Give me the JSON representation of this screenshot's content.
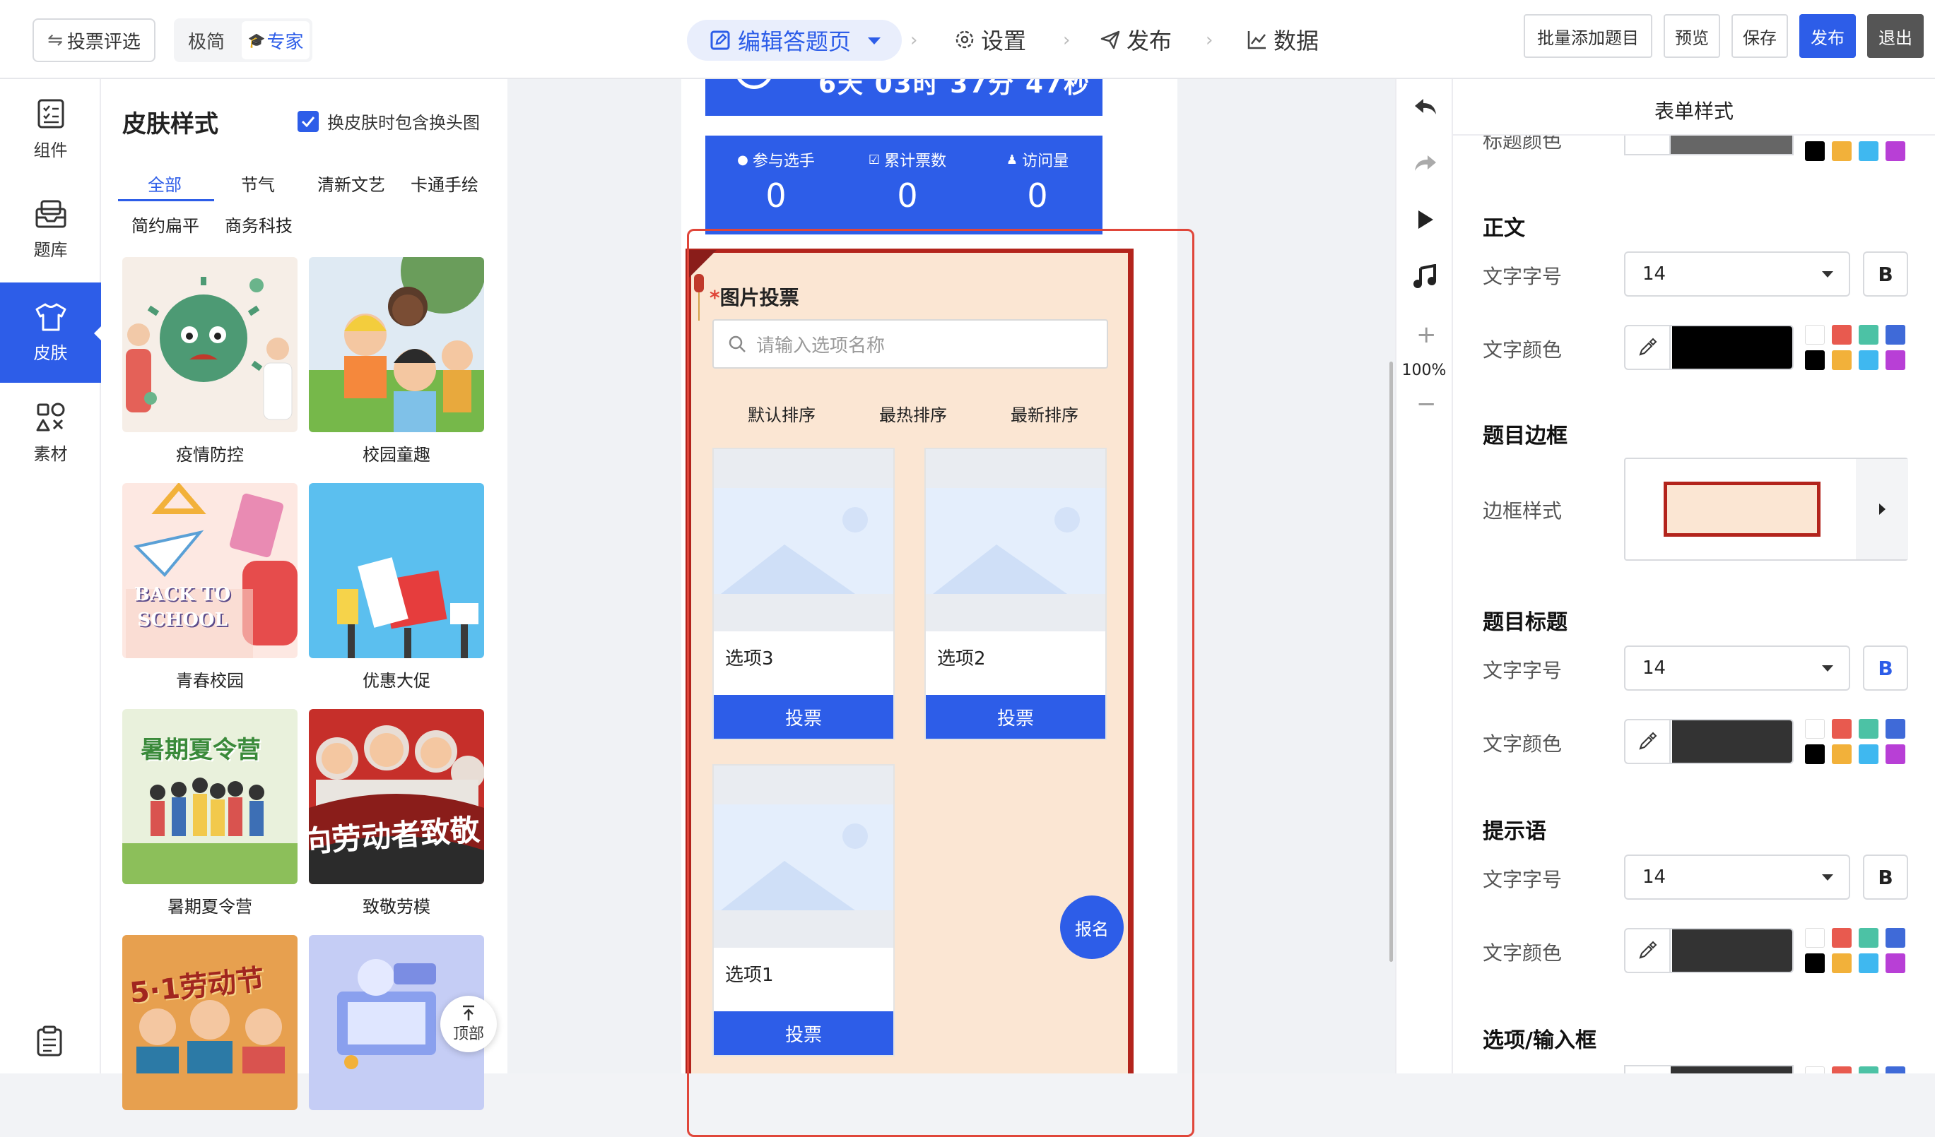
{
  "topbar": {
    "back_label": "投票评选",
    "mode_simple": "极简",
    "mode_expert": "专家",
    "nav_edit": "编辑答题页",
    "nav_settings": "设置",
    "nav_publish": "发布",
    "nav_data": "数据",
    "btn_batch_add": "批量添加题目",
    "btn_preview": "预览",
    "btn_save": "保存",
    "btn_publish": "发布",
    "btn_exit": "退出"
  },
  "rail": {
    "items": [
      {
        "label": "组件",
        "icon": "checklist-icon"
      },
      {
        "label": "题库",
        "icon": "inbox-icon"
      },
      {
        "label": "皮肤",
        "icon": "shirt-icon"
      },
      {
        "label": "素材",
        "icon": "shapes-icon"
      }
    ]
  },
  "skin_panel": {
    "title": "皮肤样式",
    "checkbox_label": "换皮肤时包含换头图",
    "checkbox_checked": true,
    "tabs": [
      "全部",
      "节气",
      "清新文艺",
      "卡通手绘",
      "简约扁平",
      "商务科技"
    ],
    "active_tab": "全部",
    "templates": [
      {
        "name": "疫情防控"
      },
      {
        "name": "校园童趣"
      },
      {
        "name": "青春校园",
        "thumb_text": "BACK TO SCHOOL"
      },
      {
        "name": "优惠大促"
      },
      {
        "name": "暑期夏令营",
        "thumb_text": "暑期夏令营"
      },
      {
        "name": "致敬劳模",
        "thumb_text": "向劳动者致敬"
      },
      {
        "name": "",
        "thumb_text": "5·1劳动节"
      },
      {
        "name": ""
      }
    ],
    "back_to_top": "顶部"
  },
  "canvas": {
    "countdown_partial": "6天 03时 37分 47秒",
    "stats": [
      {
        "label": "参与选手",
        "value": "0"
      },
      {
        "label": "累计票数",
        "value": "0"
      },
      {
        "label": "访问量",
        "value": "0"
      }
    ],
    "question_title": "图片投票",
    "required_mark": "*",
    "search_placeholder": "请输入选项名称",
    "sort_options": [
      "默认排序",
      "最热排序",
      "最新排序"
    ],
    "options": [
      {
        "name": "选项3",
        "vote": "投票"
      },
      {
        "name": "选项2",
        "vote": "投票"
      },
      {
        "name": "选项1",
        "vote": "投票"
      }
    ],
    "register_label": "报名"
  },
  "tools": {
    "zoom": "100%"
  },
  "props": {
    "header": "表单样式",
    "partial_label": "标题颜色",
    "sections": {
      "body": {
        "title": "正文",
        "font_size_label": "文字字号",
        "font_size": "14",
        "color_label": "文字颜色",
        "color": "#000000"
      },
      "border": {
        "title": "题目边框",
        "style_label": "边框样式"
      },
      "question_title": {
        "title": "题目标题",
        "font_size_label": "文字字号",
        "font_size": "14",
        "color_label": "文字颜色",
        "color": "#333333"
      },
      "hint": {
        "title": "提示语",
        "font_size_label": "文字字号",
        "font_size": "14",
        "color_label": "文字颜色",
        "color": "#333333"
      },
      "option_input": {
        "title": "选项/输入框"
      }
    },
    "palette": [
      "#ffffff",
      "#e85a4f",
      "#4cc2a5",
      "#3f6ad8",
      "#000000",
      "#f2b13a",
      "#3fb8f0",
      "#b83fd6"
    ]
  },
  "colors": {
    "accent": "#2d5de8",
    "exit": "#555555",
    "highlight_border": "#e0463a",
    "frame_red": "#b3241c",
    "frame_bg": "#fbe6d3"
  }
}
